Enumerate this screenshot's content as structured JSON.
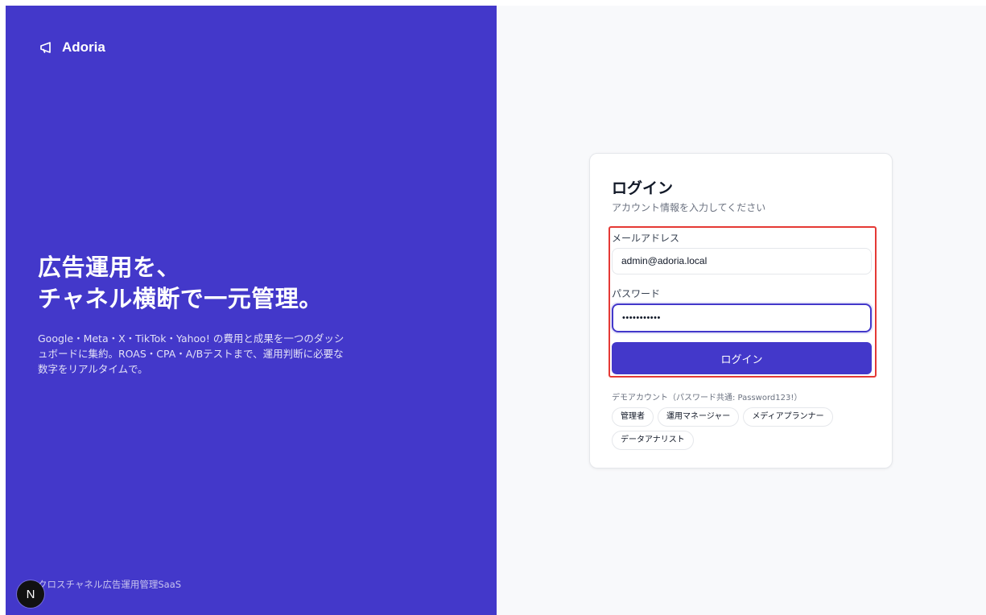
{
  "brand": {
    "name": "Adoria",
    "icon": "megaphone-icon"
  },
  "hero": {
    "title_line1": "広告運用を、",
    "title_line2": "チャネル横断で一元管理。",
    "description": "Google・Meta・X・TikTok・Yahoo! の費用と成果を一つのダッシュボードに集約。ROAS・CPA・A/Bテストまで、運用判断に必要な数字をリアルタイムで。"
  },
  "footer": {
    "tagline": "クロスチャネル広告運用管理SaaS",
    "badge": "N"
  },
  "login": {
    "title": "ログイン",
    "subtitle": "アカウント情報を入力してください",
    "email_label": "メールアドレス",
    "email_value": "admin@adoria.local",
    "password_label": "パスワード",
    "password_value": "•••••••••••",
    "submit_label": "ログイン"
  },
  "demo": {
    "heading": "デモアカウント（パスワード共通: Password123!）",
    "accounts": [
      "管理者",
      "運用マネージャー",
      "メディアプランナー",
      "データアナリスト"
    ]
  },
  "colors": {
    "primary": "#4338ca",
    "highlight": "#e53935",
    "background": "#f8f9fb"
  }
}
